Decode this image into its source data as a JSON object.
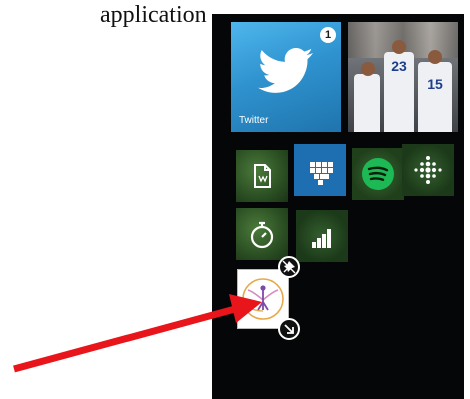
{
  "caption": "application",
  "twitter_tile": {
    "name": "Twitter",
    "badge": "1"
  },
  "photo_tile": {
    "jersey_numbers": [
      "23",
      "15"
    ]
  },
  "small_tiles": [
    {
      "icon": "document-icon"
    },
    {
      "icon": "heart-pixel-icon"
    },
    {
      "icon": "spotify-icon"
    },
    {
      "icon": "fitbit-dots-icon"
    },
    {
      "icon": "stopwatch-icon"
    },
    {
      "icon": "signal-bars-icon"
    }
  ],
  "selected_tile": {
    "icon": "app-logo-icon"
  },
  "tile_controls": {
    "unpin": "unpin-icon",
    "resize": "resize-arrow-icon"
  },
  "colors": {
    "twitter": "#2f93cf",
    "arrow": "#e8151b",
    "background": "#050607"
  }
}
